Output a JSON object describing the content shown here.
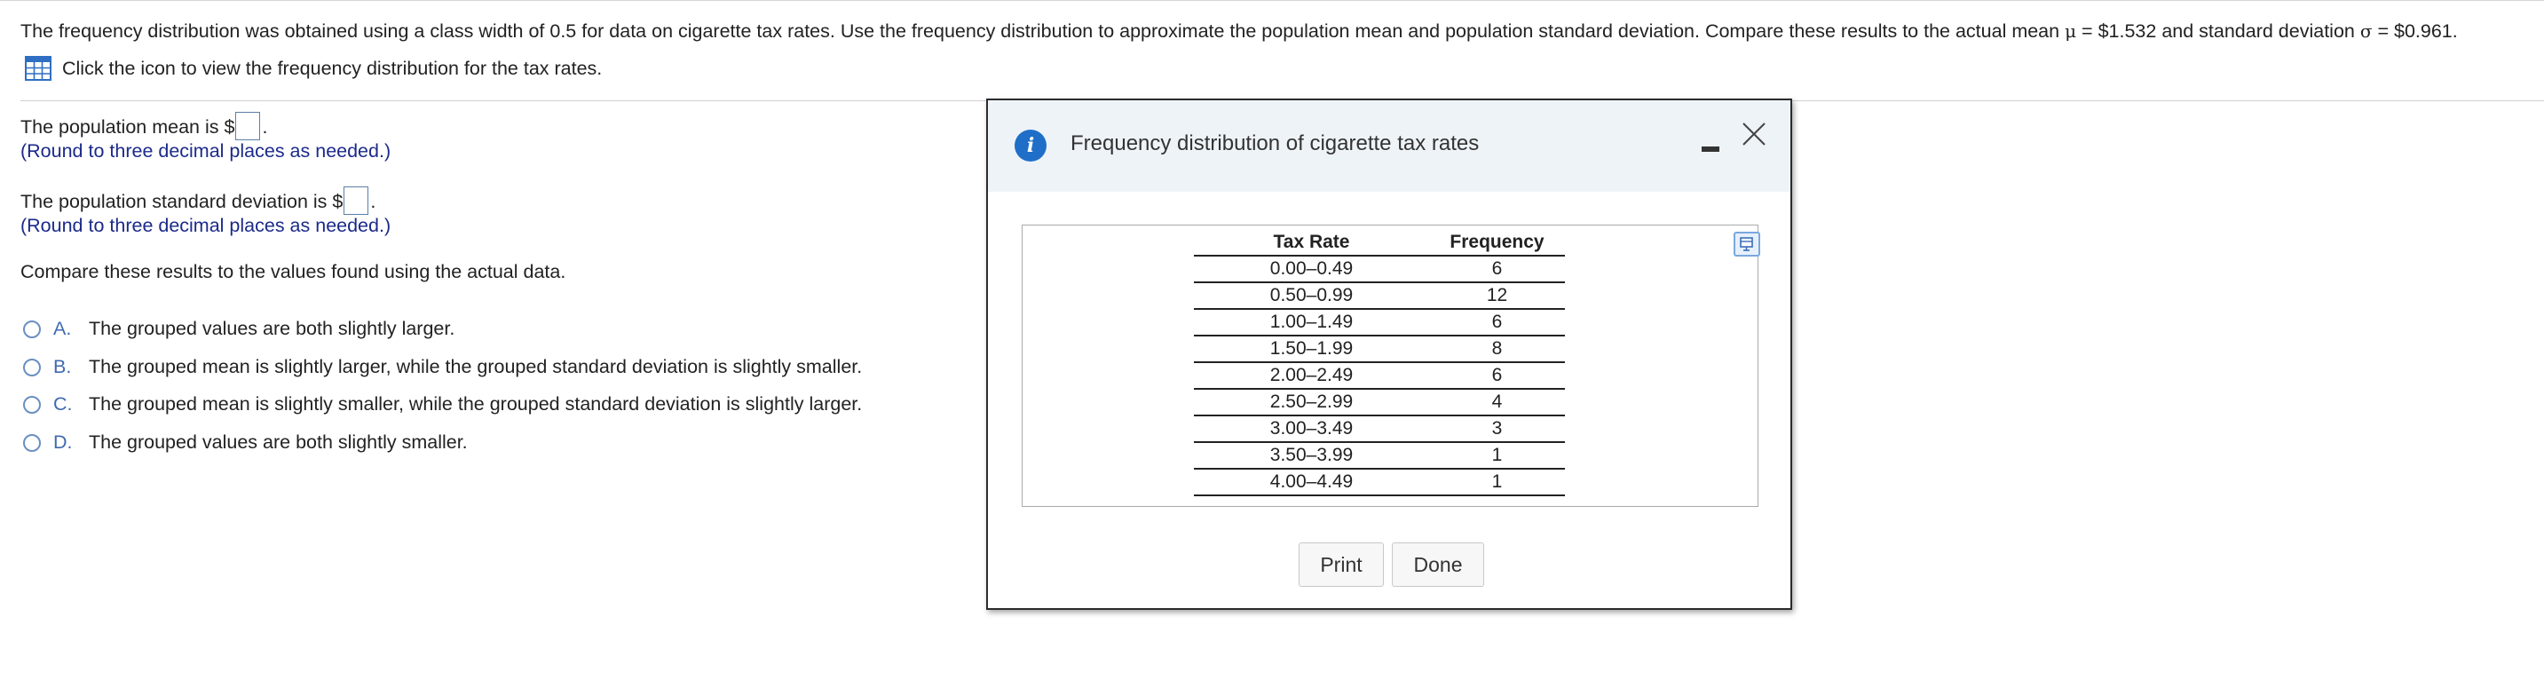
{
  "question": {
    "text_before_mu": "The frequency distribution was obtained using a class width of 0.5 for data on cigarette tax rates. Use the frequency distribution to approximate the population mean and population standard deviation. Compare these results to the actual mean ",
    "mu_symbol": "μ",
    "mean_value_text": " = $1.532 and standard deviation ",
    "sigma_symbol": "σ",
    "sd_value_text": " = $0.961."
  },
  "icon_row": {
    "icon": "table-grid-icon",
    "text": "Click the icon to view the frequency distribution for the tax rates."
  },
  "mean_prompt": {
    "before": "The population mean is $",
    "after": ".",
    "value": "",
    "hint": "(Round to three decimal places as needed.)"
  },
  "sd_prompt": {
    "before": "The population standard deviation is $",
    "after": ".",
    "value": "",
    "hint": "(Round to three decimal places as needed.)"
  },
  "compare_text": "Compare these results to the values found using the actual data.",
  "options": [
    {
      "letter": "A.",
      "text": "The grouped values are both slightly larger."
    },
    {
      "letter": "B.",
      "text": "The grouped mean is slightly larger, while the grouped standard deviation is slightly smaller."
    },
    {
      "letter": "C.",
      "text": "The grouped mean is slightly smaller, while the grouped standard deviation is slightly larger."
    },
    {
      "letter": "D.",
      "text": "The grouped values are both slightly smaller."
    }
  ],
  "modal": {
    "icon": "info-icon",
    "info_glyph": "i",
    "title": "Frequency distribution of cigarette tax rates",
    "table": {
      "headers": [
        "Tax Rate",
        "Frequency"
      ],
      "rows": [
        [
          "0.00–0.49",
          "6"
        ],
        [
          "0.50–0.99",
          "12"
        ],
        [
          "1.00–1.49",
          "6"
        ],
        [
          "1.50–1.99",
          "8"
        ],
        [
          "2.00–2.49",
          "6"
        ],
        [
          "2.50–2.99",
          "4"
        ],
        [
          "3.00–3.49",
          "3"
        ],
        [
          "3.50–3.99",
          "1"
        ],
        [
          "4.00–4.49",
          "1"
        ]
      ]
    },
    "print_label": "Print",
    "done_label": "Done"
  },
  "colors": {
    "hint": "#1b2a8a",
    "option_letter": "#3f6ab0",
    "info_icon": "#1f6fc8",
    "modal_header_bg": "#eef3f8"
  }
}
